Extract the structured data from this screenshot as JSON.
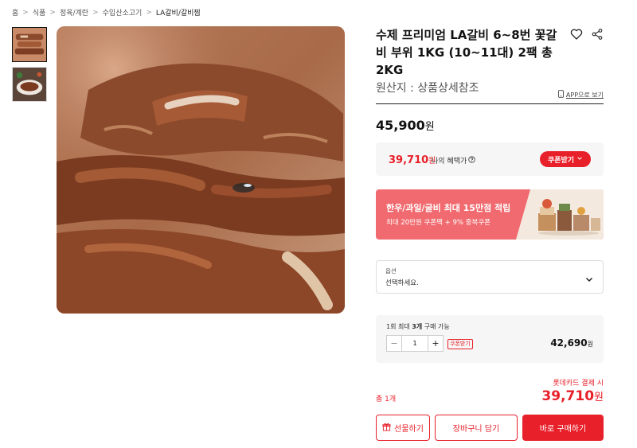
{
  "breadcrumb": {
    "items": [
      "홈",
      "식품",
      "정육/계란",
      "수입산소고기",
      "LA갈비/갈비찜"
    ],
    "separator": ">"
  },
  "product": {
    "title": "수제 프리미엄 LA갈비 6~8번 꽃갈비 부위 1KG (10~11대) 2팩 총 2KG",
    "origin": "원산지 : 상품상세참조",
    "app_link": "APP으로 보기",
    "price": "45,900",
    "price_unit": "원"
  },
  "benefit": {
    "price": "39,710",
    "unit": "원",
    "label": "나의 혜택가",
    "coupon_button": "쿠폰받기"
  },
  "banner": {
    "title": "한우/과일/굴비 최대 15만점 적립",
    "subtitle": "최대 20만원 쿠폰팩 + 9% 중복쿠폰"
  },
  "option": {
    "label": "옵션",
    "placeholder": "선택하세요."
  },
  "quantity": {
    "limit_prefix": "1회 최대 ",
    "limit_bold": "3개",
    "limit_suffix": " 구매 가능",
    "value": "1",
    "minus": "−",
    "plus": "+",
    "coupon_tag": "쿠폰받기",
    "price": "42,690",
    "unit": "원"
  },
  "total": {
    "label": "총 1개",
    "card_note": "롯데카드 결제 시",
    "price": "39,710",
    "unit": "원"
  },
  "actions": {
    "gift": "선물하기",
    "cart": "장바구니 담기",
    "buy": "바로 구매하기"
  },
  "colors": {
    "accent": "#e8202a",
    "banner": "#f06a6f",
    "panel": "#f6f6f6"
  },
  "icons": {
    "wishlist": "heart-icon",
    "share": "share-icon",
    "app": "mobile-icon",
    "info": "info-icon",
    "chevron": "chevron-down-icon",
    "gift": "gift-icon"
  }
}
